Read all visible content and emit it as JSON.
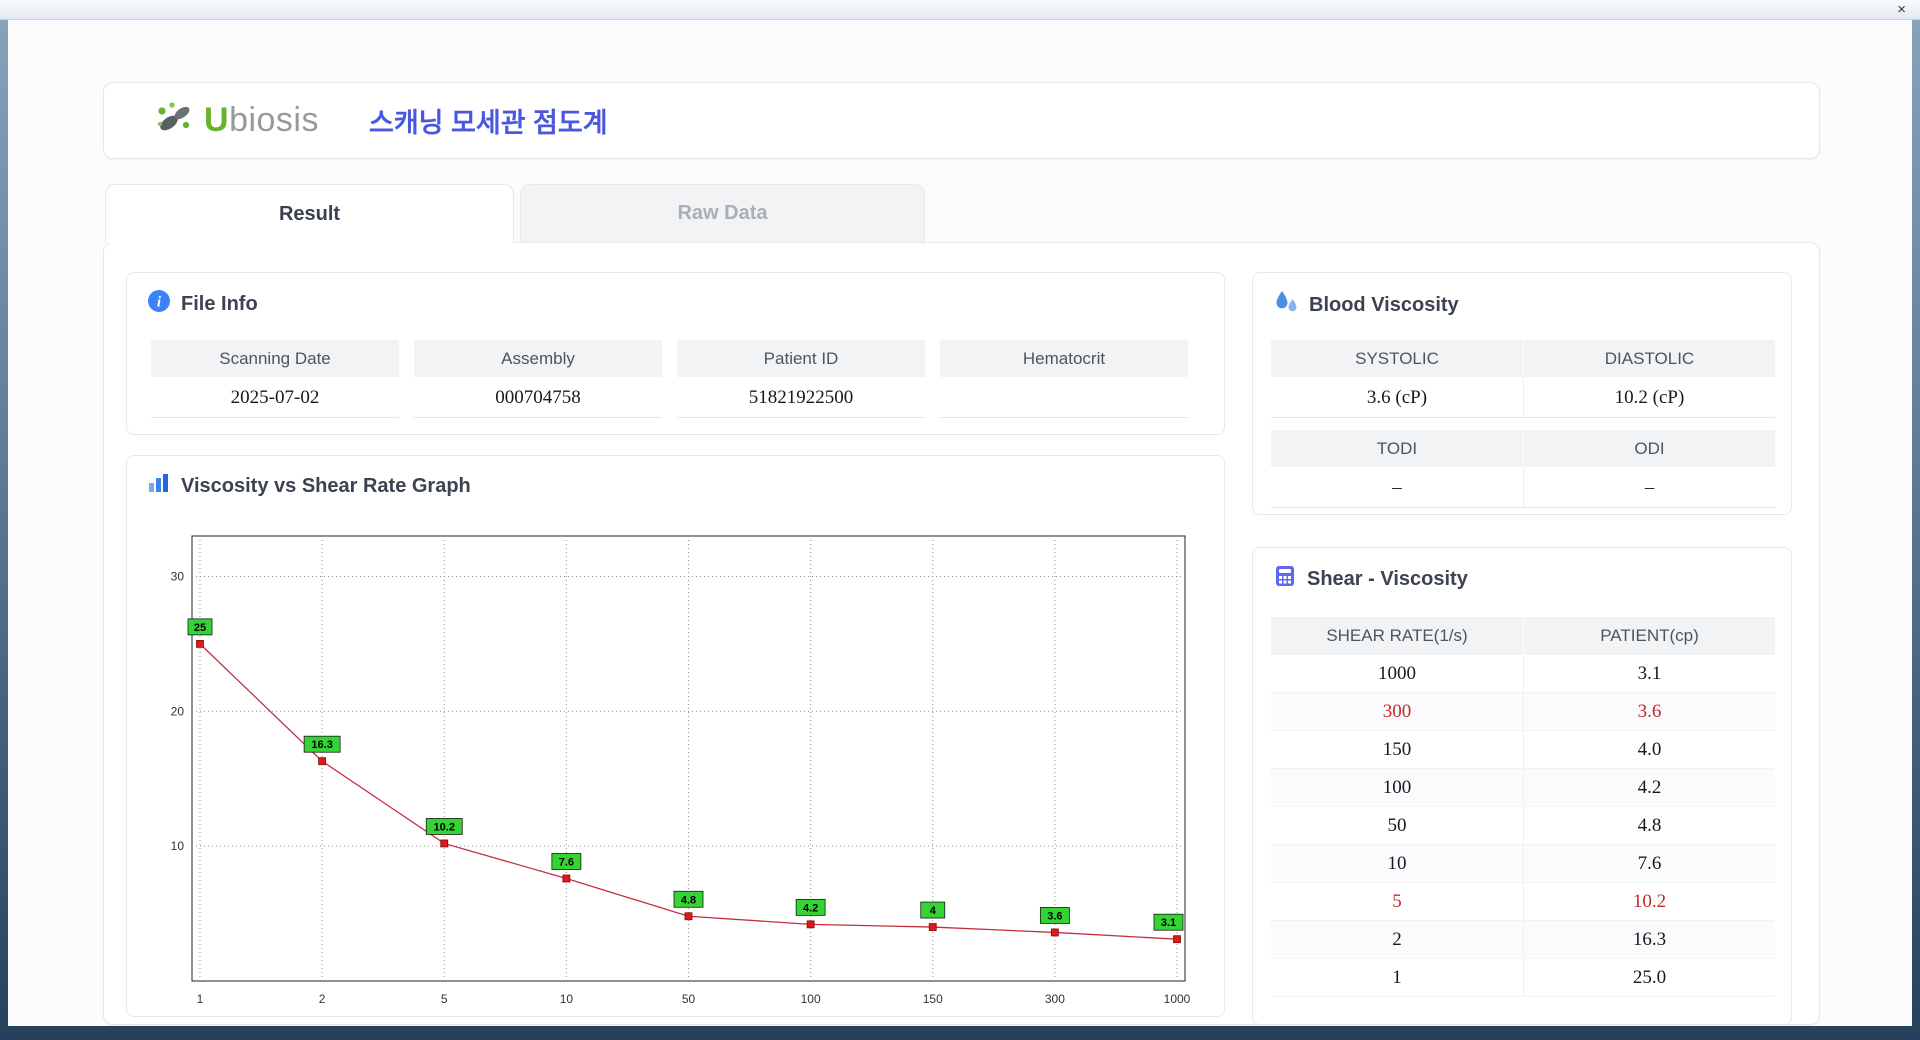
{
  "window": {
    "close_icon": "×"
  },
  "header": {
    "logo_text": "Ubiosis",
    "title": "스캐닝 모세관 점도계"
  },
  "tabs": [
    {
      "label": "Result",
      "active": true
    },
    {
      "label": "Raw Data",
      "active": false
    }
  ],
  "file_info": {
    "title": "File Info",
    "fields": [
      {
        "label": "Scanning Date",
        "value": "2025-07-02"
      },
      {
        "label": "Assembly",
        "value": "000704758"
      },
      {
        "label": "Patient ID",
        "value": "51821922500"
      },
      {
        "label": "Hematocrit",
        "value": ""
      }
    ]
  },
  "blood_viscosity": {
    "title": "Blood Viscosity",
    "rows": [
      {
        "labels": [
          "SYSTOLIC",
          "DIASTOLIC"
        ],
        "values": [
          "3.6 (cP)",
          "10.2 (cP)"
        ]
      },
      {
        "labels": [
          "TODI",
          "ODI"
        ],
        "values": [
          "–",
          "–"
        ]
      }
    ]
  },
  "shear_viscosity": {
    "title": "Shear - Viscosity",
    "columns": [
      "SHEAR RATE(1/s)",
      "PATIENT(cp)"
    ],
    "rows": [
      {
        "shear": "1000",
        "patient": "3.1",
        "highlight": false
      },
      {
        "shear": "300",
        "patient": "3.6",
        "highlight": true
      },
      {
        "shear": "150",
        "patient": "4.0",
        "highlight": false
      },
      {
        "shear": "100",
        "patient": "4.2",
        "highlight": false
      },
      {
        "shear": "50",
        "patient": "4.8",
        "highlight": false
      },
      {
        "shear": "10",
        "patient": "7.6",
        "highlight": false
      },
      {
        "shear": "5",
        "patient": "10.2",
        "highlight": true
      },
      {
        "shear": "2",
        "patient": "16.3",
        "highlight": false
      },
      {
        "shear": "1",
        "patient": "25.0",
        "highlight": false
      }
    ]
  },
  "graph": {
    "title": "Viscosity vs Shear Rate Graph"
  },
  "chart_data": {
    "type": "line",
    "title": "Viscosity vs Shear Rate Graph",
    "categories": [
      1,
      2,
      5,
      10,
      50,
      100,
      150,
      300,
      1000
    ],
    "values": [
      25,
      16.3,
      10.2,
      7.6,
      4.8,
      4.2,
      4,
      3.6,
      3.1
    ],
    "labels": [
      "25",
      "16.3",
      "10.2",
      "7.6",
      "4.8",
      "4.2",
      "4",
      "3.6",
      "3.1"
    ],
    "xlabel": "",
    "ylabel": "",
    "yticks": [
      10,
      20,
      30
    ],
    "ylim": [
      0,
      33
    ],
    "grid": "dotted",
    "legend": "none",
    "line_color": "#c23040",
    "marker_color": "#e01818",
    "marker_edge": "#7c0f0f",
    "label_bg": "#35d435",
    "label_border": "#1a1a1a"
  }
}
